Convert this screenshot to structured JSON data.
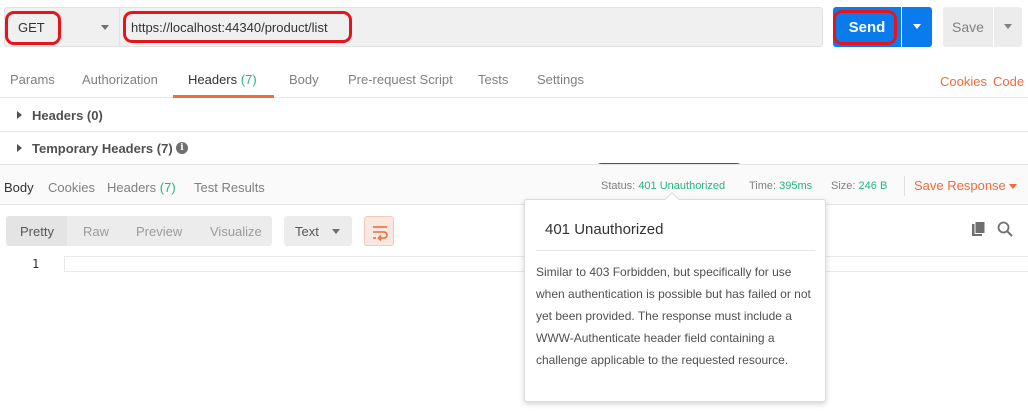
{
  "request": {
    "method": "GET",
    "url": "https://localhost:44340/product/list",
    "send_label": "Send",
    "save_label": "Save"
  },
  "request_tabs": {
    "params": "Params",
    "authorization": "Authorization",
    "headers": "Headers",
    "headers_count": "(7)",
    "body": "Body",
    "prerequest": "Pre-request Script",
    "tests": "Tests",
    "settings": "Settings",
    "cookies": "Cookies",
    "code": "Code"
  },
  "sections": {
    "headers": "Headers (0)",
    "temporary_headers": "Temporary Headers (7)"
  },
  "response_tabs": {
    "body": "Body",
    "cookies": "Cookies",
    "headers": "Headers",
    "headers_count": "(7)",
    "test_results": "Test Results"
  },
  "response_meta": {
    "status_label": "Status:",
    "status_value": "401 Unauthorized",
    "time_label": "Time:",
    "time_value": "395ms",
    "size_label": "Size:",
    "size_value": "246 B",
    "save_response": "Save Response"
  },
  "view_modes": {
    "pretty": "Pretty",
    "raw": "Raw",
    "preview": "Preview",
    "visualize": "Visualize",
    "format": "Text"
  },
  "editor": {
    "line_number": "1"
  },
  "tooltip": {
    "title": "401 Unauthorized",
    "description": "Similar to 403 Forbidden, but specifically for use when authentication is possible but has failed or not yet been provided. The response must include a WWW-Authenticate header field containing a challenge applicable to the requested resource."
  },
  "colors": {
    "accent_orange": "#f26b3a",
    "send_blue": "#097bed",
    "status_green": "#26b47f",
    "annotation_red": "#e8141c"
  }
}
